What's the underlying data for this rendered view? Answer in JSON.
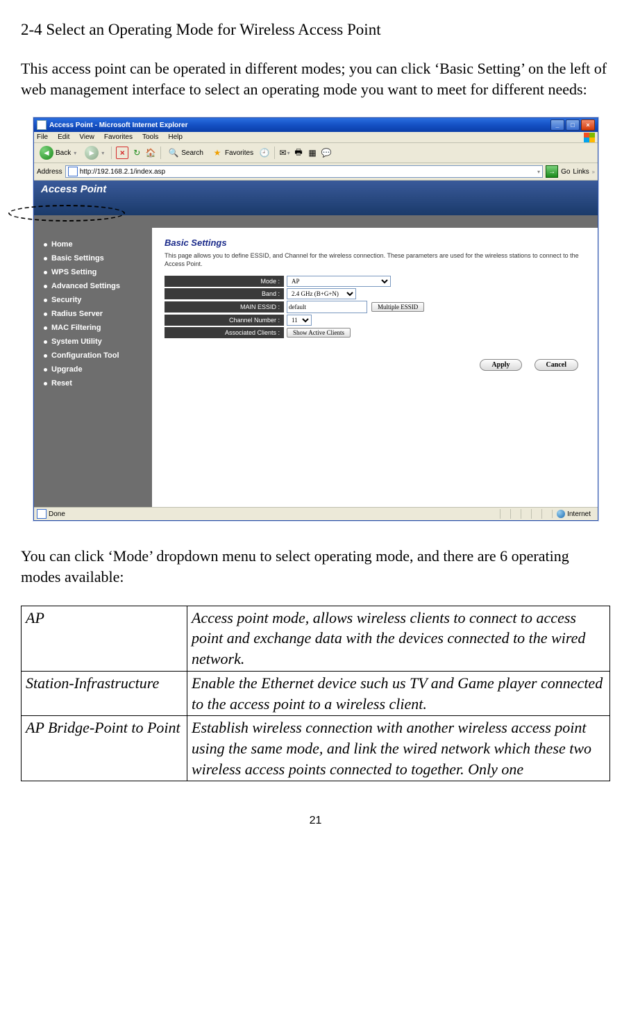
{
  "section_title": "2-4 Select an Operating Mode for Wireless Access Point",
  "intro_text": "This access point can be operated in different modes; you can click ‘Basic Setting’ on the left of web management interface to select an operating mode you want to meet for different needs:",
  "browser": {
    "window_title": "Access Point - Microsoft Internet Explorer",
    "menus": [
      "File",
      "Edit",
      "View",
      "Favorites",
      "Tools",
      "Help"
    ],
    "toolbar": {
      "back": "Back",
      "search": "Search",
      "favorites": "Favorites"
    },
    "address_label": "Address",
    "url": "http://192.168.2.1/index.asp",
    "go_label": "Go",
    "links_label": "Links",
    "status_left": "Done",
    "status_right": "Internet"
  },
  "page": {
    "brand": "Access Point",
    "nav": [
      "Home",
      "Basic Settings",
      "WPS Setting",
      "Advanced Settings",
      "Security",
      "Radius Server",
      "MAC Filtering",
      "System Utility",
      "Configuration Tool",
      "Upgrade",
      "Reset"
    ],
    "nav_selected_index": 1,
    "heading": "Basic Settings",
    "description": "This page allows you to define ESSID, and Channel for the wireless connection. These parameters are used for the wireless stations to connect to the Access Point.",
    "fields": {
      "mode": {
        "label": "Mode :",
        "value": "AP"
      },
      "band": {
        "label": "Band :",
        "value": "2.4 GHz (B+G+N)"
      },
      "essid": {
        "label": "MAIN ESSID :",
        "value": "default",
        "button": "Multiple ESSID"
      },
      "channel": {
        "label": "Channel Number :",
        "value": "11"
      },
      "clients": {
        "label": "Associated Clients :",
        "button": "Show Active Clients"
      }
    },
    "apply": "Apply",
    "cancel": "Cancel"
  },
  "post_text": "You can click ‘Mode’ dropdown menu to select operating mode, and there are 6 operating modes available:",
  "modes_table": [
    {
      "name": "AP",
      "desc": "Access point mode, allows wireless clients to connect to access point and exchange data with the devices connected to the wired network."
    },
    {
      "name": "Station-Infrastructure",
      "desc": "Enable the Ethernet device such us TV and Game player connected to the access point to a wireless client."
    },
    {
      "name": "AP Bridge-Point to Point",
      "desc": "Establish wireless connection with another wireless access point using the same mode, and link the wired network which these two wireless access points connected to together. Only one"
    }
  ],
  "page_number": "21"
}
